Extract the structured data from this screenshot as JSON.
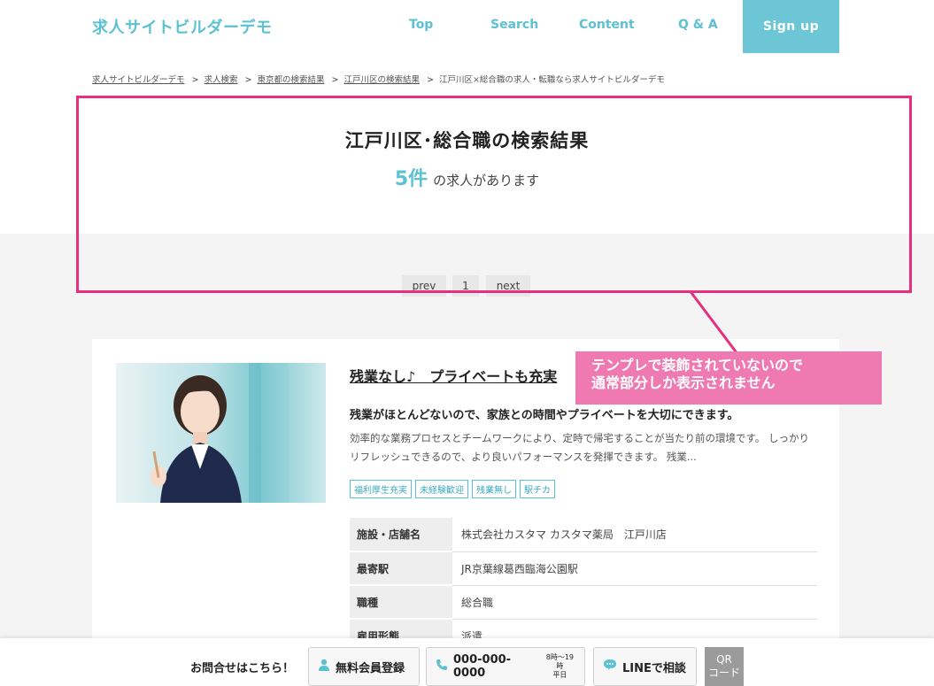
{
  "header": {
    "logo": "求人サイトビルダーデモ",
    "nav": [
      "Top",
      "Search",
      "Content",
      "Q & A"
    ],
    "signup": "Sign up"
  },
  "breadcrumb": {
    "items": [
      "求人サイトビルダーデモ",
      "求人検索",
      "東京都の検索結果",
      "江戸川区の検索結果",
      "江戸川区×総合職の求人・転職なら求人サイトビルダーデモ"
    ]
  },
  "results": {
    "title": "江戸川区･総合職の検索結果",
    "count": "5件",
    "count_suffix": "の求人があります"
  },
  "pagination": {
    "prev": "prev",
    "page": "1",
    "next": "next"
  },
  "annotation": {
    "line1": "テンプレで装飾されていないので",
    "line2": "通常部分しか表示されません",
    "color": "#e6307e"
  },
  "job": {
    "title": "残業なし♪　プライベートも充実",
    "subtitle": "残業がほとんどないので、家族との時間やプライベートを大切にできます。",
    "description": "効率的な業務プロセスとチームワークにより、定時で帰宅することが当たり前の環境です。 しっかりリフレッシュできるので、より良いパフォーマンスを発揮できます。 残業...",
    "tags": [
      "福利厚生充実",
      "未経験歓迎",
      "残業無し",
      "駅チカ"
    ],
    "info": [
      {
        "label": "施設・店舗名",
        "value": "株式会社カスタマ カスタマ薬局　江戸川店"
      },
      {
        "label": "最寄駅",
        "value": "JR京葉線葛西臨海公園駅"
      },
      {
        "label": "職種",
        "value": "総合職"
      },
      {
        "label": "雇用形態",
        "value": "派遣"
      }
    ]
  },
  "footer": {
    "label": "お問合せはこちら！",
    "register": "無料会員登録",
    "phone": "000-000-0000",
    "hours_line1": "8時～19時",
    "hours_line2": "平日",
    "line": "LINEで相談",
    "qr_line1": "QR",
    "qr_line2": "コード"
  },
  "colors": {
    "accent": "#5cc1d2",
    "annotation": "#e6307e",
    "callout_bg": "#ef7ab2"
  }
}
